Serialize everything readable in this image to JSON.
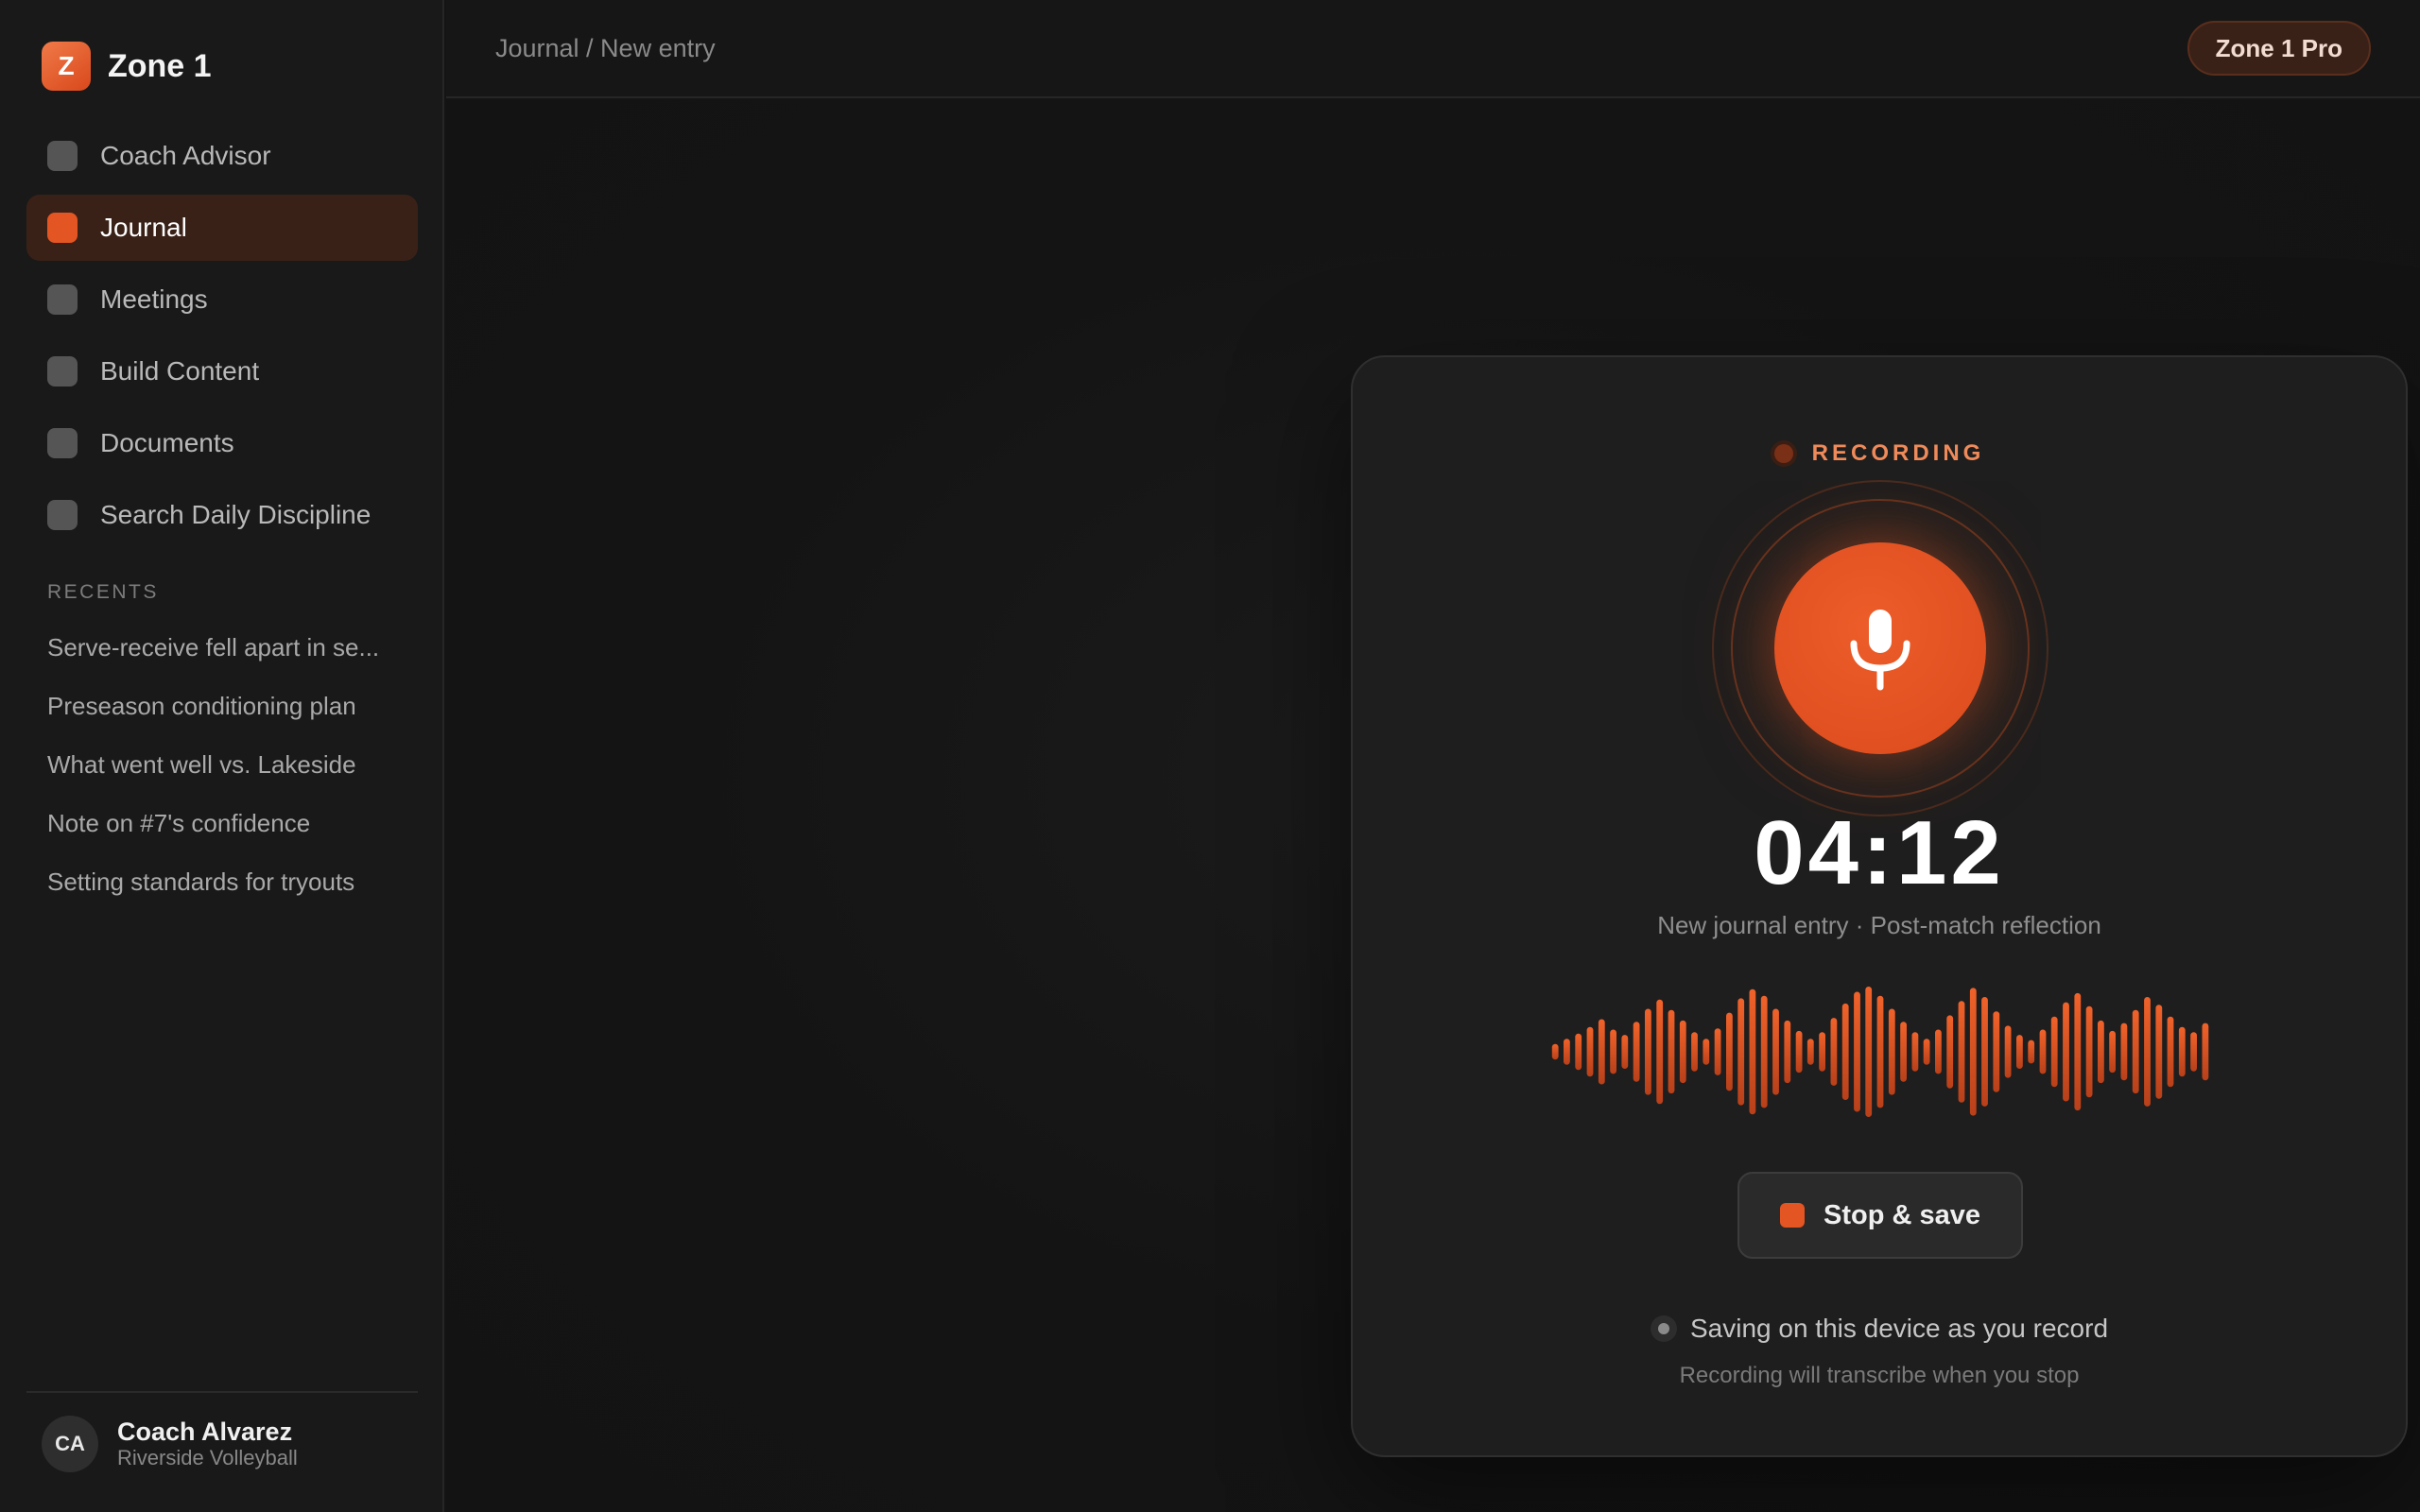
{
  "brand": {
    "logo_letter": "Z",
    "name": "Zone 1"
  },
  "nav": {
    "items": [
      {
        "label": "Coach Advisor",
        "active": false
      },
      {
        "label": "Journal",
        "active": true
      },
      {
        "label": "Meetings",
        "active": false
      },
      {
        "label": "Build Content",
        "active": false
      },
      {
        "label": "Documents",
        "active": false
      },
      {
        "label": "Search Daily Discipline",
        "active": false
      }
    ]
  },
  "recents": {
    "title": "RECENTS",
    "items": [
      "Serve-receive fell apart in se...",
      "Preseason conditioning plan",
      "What went well vs. Lakeside",
      "Note on #7's confidence",
      "Setting standards for tryouts"
    ]
  },
  "user": {
    "initials": "CA",
    "name": "Coach Alvarez",
    "org": "Riverside Volleyball"
  },
  "header": {
    "breadcrumb": "Journal / New entry",
    "plan_badge": "Zone 1 Pro"
  },
  "recorder": {
    "status_label": "RECORDING",
    "timer": "04:12",
    "subtitle": "New journal entry · Post-match reflection",
    "stop_label": "Stop & save",
    "saving_status": "Saving on this device as you record",
    "hint": "Recording will transcribe when you stop",
    "waveform_levels": [
      0.12,
      0.2,
      0.28,
      0.38,
      0.5,
      0.34,
      0.26,
      0.46,
      0.66,
      0.8,
      0.64,
      0.48,
      0.3,
      0.2,
      0.36,
      0.6,
      0.82,
      0.96,
      0.86,
      0.66,
      0.48,
      0.32,
      0.2,
      0.3,
      0.52,
      0.74,
      0.92,
      1.0,
      0.86,
      0.66,
      0.46,
      0.3,
      0.2,
      0.34,
      0.56,
      0.78,
      0.98,
      0.84,
      0.62,
      0.4,
      0.26,
      0.18,
      0.34,
      0.54,
      0.76,
      0.9,
      0.7,
      0.48,
      0.32,
      0.44,
      0.64,
      0.84,
      0.72,
      0.54,
      0.38,
      0.3,
      0.44
    ]
  },
  "colors": {
    "accent": "#e35522",
    "background": "#141414",
    "sidebar": "#191919",
    "card": "#1e1e1e"
  },
  "icons": {
    "mic": "microphone-icon",
    "stop": "stop-square-icon"
  }
}
